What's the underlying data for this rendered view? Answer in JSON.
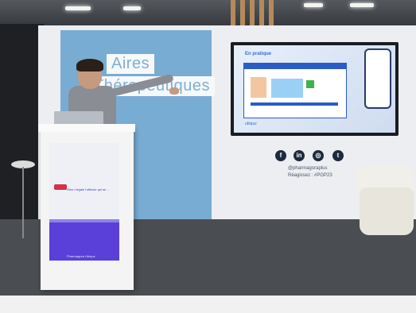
{
  "wall": {
    "title_line1": "Aires",
    "title_line2": "Thérapeutiques"
  },
  "tv": {
    "heading": "En pratique",
    "footer": "ubiquz"
  },
  "social": {
    "icons": [
      "facebook-icon",
      "linkedin-icon",
      "instagram-icon",
      "twitter-icon"
    ],
    "glyphs": [
      "f",
      "in",
      "◎",
      "t"
    ],
    "handle": "@pharmagoraplus",
    "hashtag": "Réagissez : #PGP23"
  },
  "lectern": {
    "screen_text": "Rien n'égale l'officine qui se ...",
    "screen_footer": "Pharmagora  Ubiquz"
  },
  "colors": {
    "wall_blue": "#79acd2",
    "wall_white": "#eceef1",
    "screen_purple": "#5a3fd8"
  }
}
